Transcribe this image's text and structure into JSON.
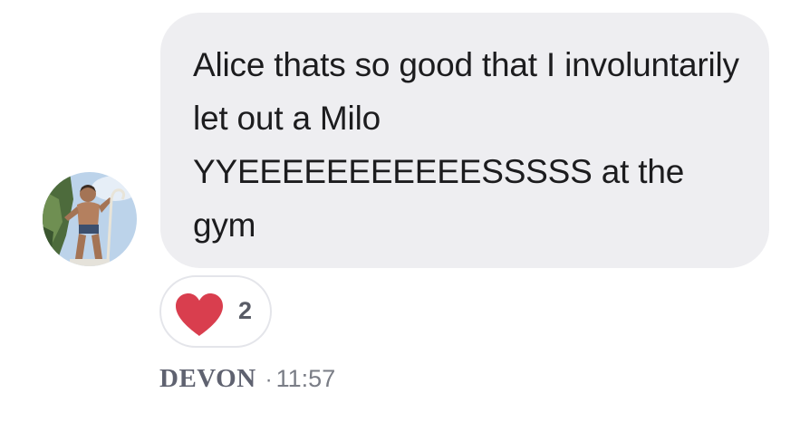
{
  "message": {
    "text": "Alice thats so good that I involuntarily let out a Milo YYEEEEEEEEEEESSSSS at the gym"
  },
  "reaction": {
    "icon": "heart-icon",
    "color": "#d93e4e",
    "count": "2"
  },
  "meta": {
    "author": "DEVON",
    "separator": "·",
    "time": "11:57"
  },
  "colors": {
    "bubble": "#eeeef1",
    "text": "#1c1c1e",
    "meta": "#7a7d86"
  }
}
